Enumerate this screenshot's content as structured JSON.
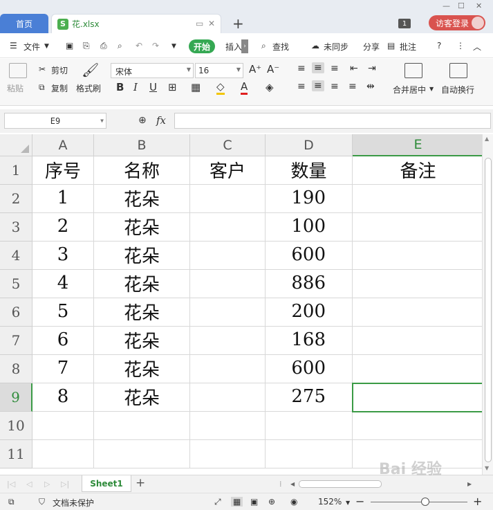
{
  "titlebar": {
    "home_tab": "首页",
    "doc_tab": "花.xlsx",
    "doc_badge": "S",
    "tab_count": "1",
    "login": "访客登录"
  },
  "menu": {
    "file": "文件",
    "start": "开始",
    "insert": "插入",
    "find": "查找",
    "sync": "未同步",
    "share": "分享",
    "review": "批注"
  },
  "ribbon": {
    "paste": "粘贴",
    "cut": "剪切",
    "copy": "复制",
    "format_painter": "格式刷",
    "font": "宋体",
    "font_size": "16",
    "merge_center": "合并居中",
    "wrap_text": "自动换行"
  },
  "formula_bar": {
    "name_box": "E9",
    "fx": "fx",
    "formula": ""
  },
  "sheet": {
    "columns": [
      "A",
      "B",
      "C",
      "D",
      "E"
    ],
    "selected_column": "E",
    "selected_row": "9",
    "row_numbers": [
      "1",
      "2",
      "3",
      "4",
      "5",
      "6",
      "7",
      "8",
      "9",
      "10",
      "11"
    ],
    "headers": [
      "序号",
      "名称",
      "客户",
      "数量",
      "备注"
    ],
    "rows": [
      [
        "1",
        "花朵",
        "",
        "190",
        ""
      ],
      [
        "2",
        "花朵",
        "",
        "100",
        ""
      ],
      [
        "3",
        "花朵",
        "",
        "600",
        ""
      ],
      [
        "4",
        "花朵",
        "",
        "886",
        ""
      ],
      [
        "5",
        "花朵",
        "",
        "200",
        ""
      ],
      [
        "6",
        "花朵",
        "",
        "168",
        ""
      ],
      [
        "7",
        "花朵",
        "",
        "600",
        ""
      ],
      [
        "8",
        "花朵",
        "",
        "275",
        ""
      ]
    ]
  },
  "sheet_tabs": {
    "active": "Sheet1",
    "add": "+"
  },
  "status": {
    "protect": "文档未保护",
    "zoom": "152%"
  },
  "watermark": "Bai 经验",
  "colors": {
    "accent_green": "#3a9a45",
    "home_tab_blue": "#4a7fd6",
    "login_red": "#d9534f"
  }
}
